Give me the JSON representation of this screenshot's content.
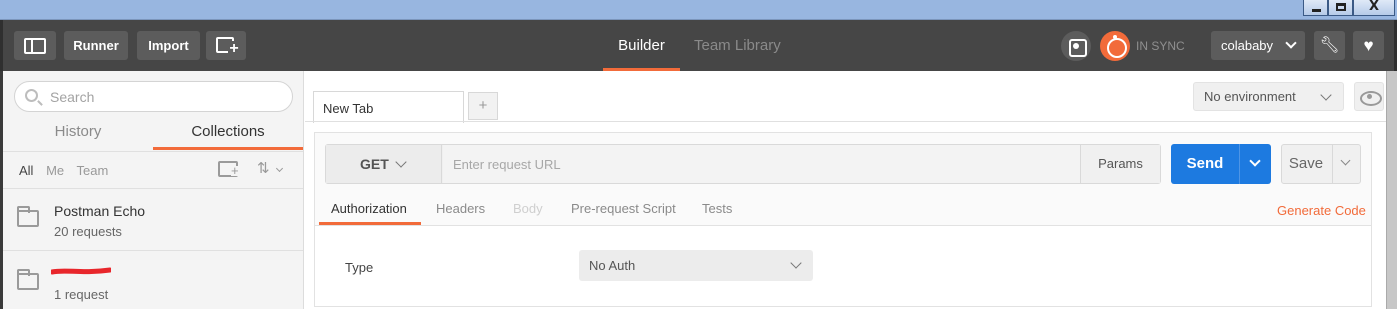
{
  "window": {
    "minimize_icon": "minimize-icon",
    "maximize_icon": "maximize-icon",
    "close_glyph": "X"
  },
  "header": {
    "runner_label": "Runner",
    "import_label": "Import",
    "tabs": [
      {
        "label": "Builder",
        "active": true
      },
      {
        "label": "Team Library",
        "active": false
      }
    ],
    "sync_status": "IN SYNC",
    "user": "colababy",
    "accent_color": "#f26b3a"
  },
  "sidebar": {
    "search_placeholder": "Search",
    "tabs": [
      {
        "label": "History",
        "active": false
      },
      {
        "label": "Collections",
        "active": true
      }
    ],
    "filters": [
      {
        "label": "All",
        "active": true
      },
      {
        "label": "Me",
        "active": false
      },
      {
        "label": "Team",
        "active": false
      }
    ],
    "collections": [
      {
        "name": "Postman Echo",
        "count": "20 requests",
        "redacted": false
      },
      {
        "name": "",
        "count": "1 request",
        "redacted": true
      }
    ]
  },
  "main": {
    "tab_label": "New Tab",
    "add_tab_glyph": "+",
    "environment": "No environment",
    "method": "GET",
    "url_placeholder": "Enter request URL",
    "params_label": "Params",
    "send_label": "Send",
    "send_color": "#1d7ae0",
    "save_label": "Save",
    "request_tabs": [
      {
        "label": "Authorization",
        "active": true,
        "disabled": false
      },
      {
        "label": "Headers",
        "active": false,
        "disabled": false
      },
      {
        "label": "Body",
        "active": false,
        "disabled": true
      },
      {
        "label": "Pre-request Script",
        "active": false,
        "disabled": false
      },
      {
        "label": "Tests",
        "active": false,
        "disabled": false
      }
    ],
    "generate_code_label": "Generate Code",
    "type_label": "Type",
    "auth_type": "No Auth"
  }
}
